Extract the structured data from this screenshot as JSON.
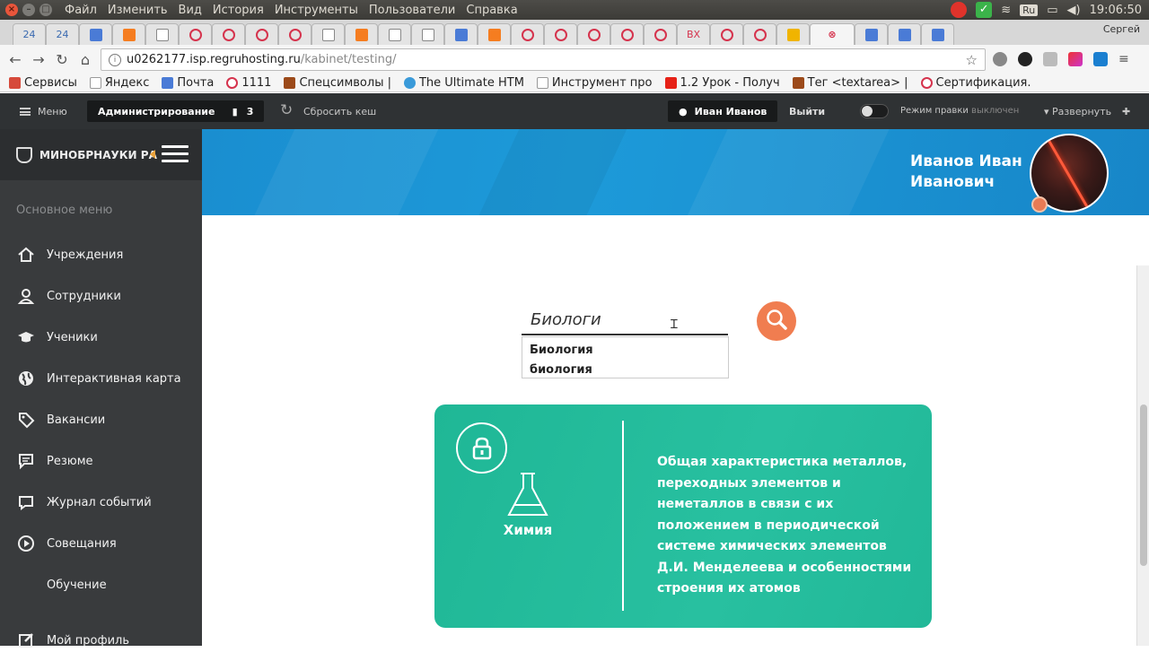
{
  "os": {
    "menu": [
      "Файл",
      "Изменить",
      "Вид",
      "История",
      "Инструменты",
      "Пользователи",
      "Справка"
    ],
    "keyboard_layout": "Ru",
    "time": "19:06:50"
  },
  "tabs": {
    "first_counts": [
      "24",
      "24"
    ],
    "gmail_badge": "ВХ",
    "user": "Сергей"
  },
  "address": {
    "host": "u0262177.isp.regruhosting.ru",
    "path": "/kabinet/testing/"
  },
  "bookmarks": [
    {
      "label": "Сервисы",
      "color": "#d64a3b"
    },
    {
      "label": "Яндекс",
      "color": "#cccccc"
    },
    {
      "label": "Почта",
      "color": "#4a7bd6"
    },
    {
      "label": "1111",
      "color": "#d5334d"
    },
    {
      "label": "Спецсимволы | ",
      "color": "#9c4a1a"
    },
    {
      "label": "The Ultimate HTM",
      "color": "#3a9ad9"
    },
    {
      "label": "Инструмент про",
      "color": "#cccccc"
    },
    {
      "label": "1.2 Урок - Получ",
      "color": "#e62117"
    },
    {
      "label": "Тег <textarea> | ",
      "color": "#9c4a1a"
    },
    {
      "label": "Сертификация. ",
      "color": "#d5334d"
    }
  ],
  "admin_bar": {
    "menu_label": "Меню",
    "admin_label": "Администрирование",
    "notif_count": "3",
    "reset_cache": "Сбросить кеш",
    "user_button": "Иван Иванов",
    "logout": "Выйти",
    "edit_mode": "Режим правки",
    "edit_mode_state": "выключен",
    "expand": "Развернуть"
  },
  "sidebar": {
    "brand": "МИНОБРНАУКИ РА",
    "section": "Основное меню",
    "items": [
      {
        "label": "Учреждения",
        "icon": "home-icon"
      },
      {
        "label": "Сотрудники",
        "icon": "user-icon"
      },
      {
        "label": "Ученики",
        "icon": "graduation-cap-icon"
      },
      {
        "label": "Интерактивная карта",
        "icon": "globe-icon"
      },
      {
        "label": "Вакансии",
        "icon": "tag-icon"
      },
      {
        "label": "Резюме",
        "icon": "comment-icon"
      },
      {
        "label": "Журнал событий",
        "icon": "chat-icon"
      },
      {
        "label": "Совещания",
        "icon": "play-icon"
      },
      {
        "label": "Обучение",
        "icon": ""
      },
      {
        "label": "Мой профиль",
        "icon": "edit-icon"
      }
    ]
  },
  "header": {
    "user_name_line1": "Иванов Иван",
    "user_name_line2": "Иванович"
  },
  "search": {
    "value": "Биологи",
    "suggestions": [
      "Биология",
      "биология"
    ]
  },
  "card": {
    "subject": "Химия",
    "description": "Общая характеристика металлов, переходных элементов и неметаллов в связи с их положением в периодической системе химических элементов Д.И. Менделеева и особенностями строения их атомов"
  },
  "colors": {
    "accent_orange": "#f07d50",
    "card_teal": "#21b898",
    "header_blue": "#1a8ed0",
    "sidebar": "#393b3d"
  }
}
